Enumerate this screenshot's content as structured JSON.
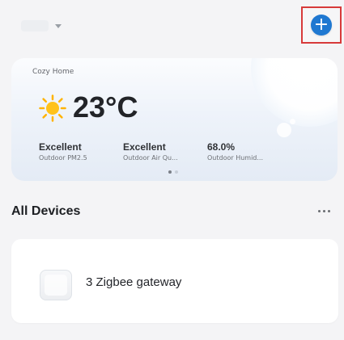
{
  "header": {
    "home_selector": {
      "selected_home": "",
      "icon": "chevron-down-icon"
    },
    "add_button": {
      "symbol": "+",
      "icon": "plus-circle-icon",
      "color": "#1f78d1",
      "highlight_color": "#d73a3a"
    }
  },
  "weather": {
    "home_label": "Cozy Home",
    "temperature": "23°C",
    "icon": "sun-icon",
    "metrics": [
      {
        "value": "Excellent",
        "label": "Outdoor PM2.5"
      },
      {
        "value": "Excellent",
        "label": "Outdoor Air Qu..."
      },
      {
        "value": "68.0%",
        "label": "Outdoor Humid..."
      }
    ],
    "pager": {
      "page": 1,
      "pages": 2
    }
  },
  "devices": {
    "title": "All Devices",
    "more_icon": "more-horizontal-icon",
    "items": [
      {
        "name": "3 Zigbee gateway",
        "icon": "zigbee-gateway-icon"
      }
    ]
  }
}
